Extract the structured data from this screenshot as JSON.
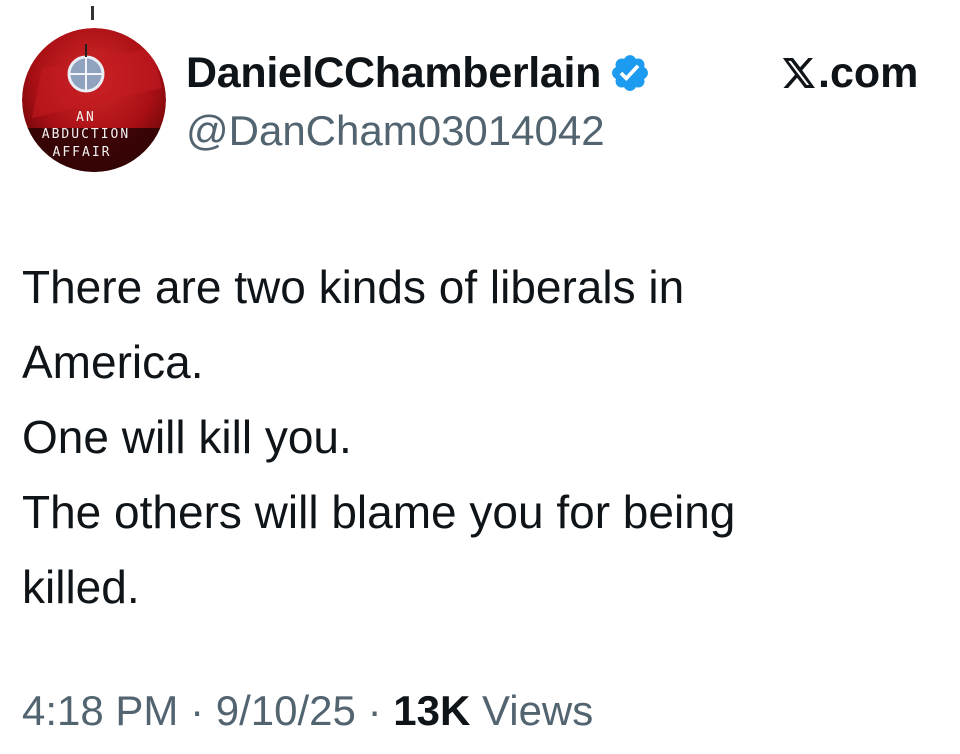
{
  "profile": {
    "display_name": "DanielCChamberlain",
    "handle": "@DanCham03014042",
    "verified": true,
    "avatar_text_line1": "AN",
    "avatar_text_line2": "ABDUCTION",
    "avatar_text_line3": "AFFAIR"
  },
  "brand": {
    "label": ".com",
    "icon": "x-logo-icon"
  },
  "tweet": {
    "lines": [
      "There are two kinds of liberals in",
      "America.",
      "One will kill you.",
      "The others will blame you for being",
      "killed."
    ]
  },
  "meta": {
    "time": "4:18 PM",
    "separator": "·",
    "date": "9/10/25",
    "views_count": "13K",
    "views_label": "Views"
  },
  "colors": {
    "verified_blue": "#1d9bf0",
    "text_primary": "#0f1419",
    "text_secondary": "#536471",
    "avatar_red": "#b3121b"
  }
}
